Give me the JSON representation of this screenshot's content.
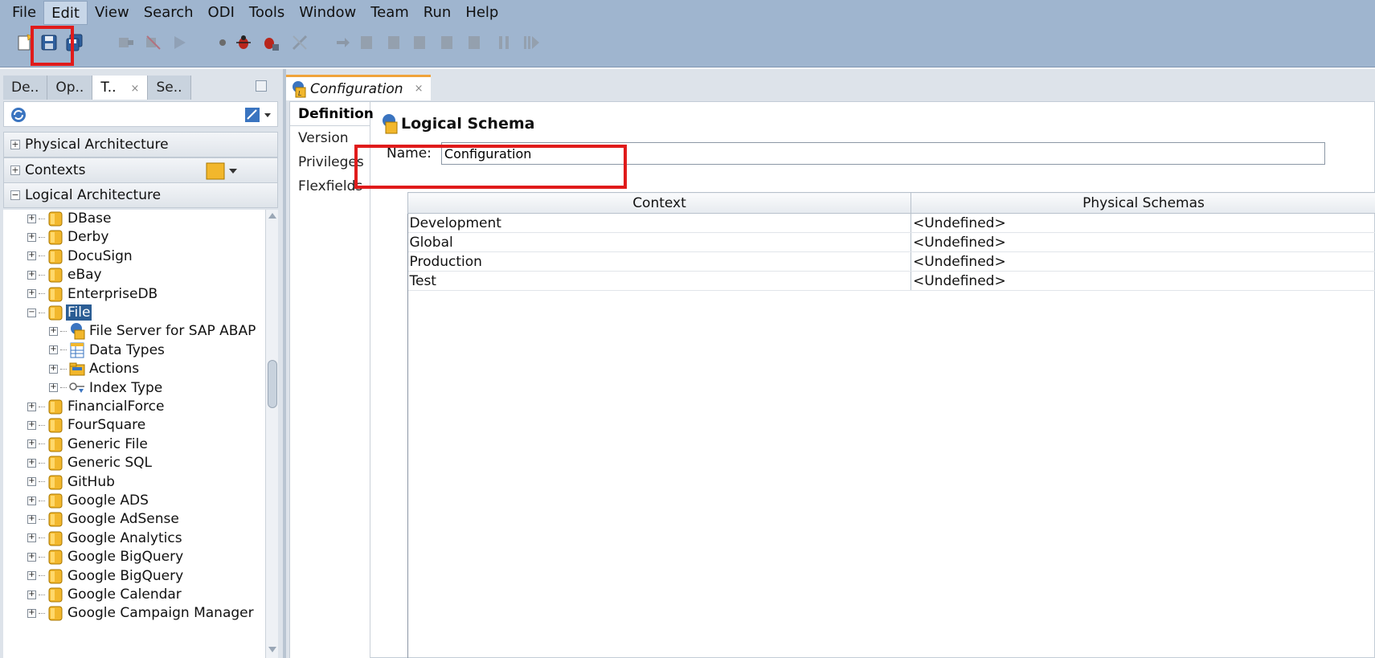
{
  "menu": [
    {
      "label": "File",
      "active": false
    },
    {
      "label": "Edit",
      "active": true
    },
    {
      "label": "View",
      "active": false
    },
    {
      "label": "Search",
      "active": false
    },
    {
      "label": "ODI",
      "active": false
    },
    {
      "label": "Tools",
      "active": false
    },
    {
      "label": "Window",
      "active": false
    },
    {
      "label": "Team",
      "active": false
    },
    {
      "label": "Run",
      "active": false
    },
    {
      "label": "Help",
      "active": false
    }
  ],
  "toolbar": {
    "icons": [
      "new-icon",
      "save-icon",
      "save-all-icon",
      "run-icon",
      "debug-icon"
    ],
    "highlight_color": "#e01b1b"
  },
  "navigator": {
    "tabs": [
      {
        "label": "De..",
        "active": false
      },
      {
        "label": "Op..",
        "active": false
      },
      {
        "label": "T..",
        "active": true
      },
      {
        "label": "Se..",
        "active": false
      }
    ],
    "close_glyph": "×",
    "accordions": {
      "physical": "Physical Architecture",
      "contexts": "Contexts",
      "logical": "Logical Architecture"
    },
    "tree": [
      {
        "label": "DBase",
        "level": 0,
        "icon": "tech-folder-icon"
      },
      {
        "label": "Derby",
        "level": 0,
        "icon": "tech-folder-icon"
      },
      {
        "label": "DocuSign",
        "level": 0,
        "icon": "tech-folder-icon"
      },
      {
        "label": "eBay",
        "level": 0,
        "icon": "tech-folder-icon"
      },
      {
        "label": "EnterpriseDB",
        "level": 0,
        "icon": "tech-folder-icon"
      },
      {
        "label": "File",
        "level": 0,
        "icon": "tech-folder-icon",
        "expanded": true,
        "selected": true
      },
      {
        "label": "File Server for SAP ABAP",
        "level": 1,
        "icon": "logical-schema-icon"
      },
      {
        "label": "Data Types",
        "level": 1,
        "icon": "datatypes-icon"
      },
      {
        "label": "Actions",
        "level": 1,
        "icon": "actions-folder-icon"
      },
      {
        "label": "Index Type",
        "level": 1,
        "icon": "index-key-icon"
      },
      {
        "label": "FinancialForce",
        "level": 0,
        "icon": "tech-folder-icon"
      },
      {
        "label": "FourSquare",
        "level": 0,
        "icon": "tech-folder-icon"
      },
      {
        "label": "Generic File",
        "level": 0,
        "icon": "tech-folder-icon"
      },
      {
        "label": "Generic SQL",
        "level": 0,
        "icon": "tech-folder-icon"
      },
      {
        "label": "GitHub",
        "level": 0,
        "icon": "tech-folder-icon"
      },
      {
        "label": "Google ADS",
        "level": 0,
        "icon": "tech-folder-icon"
      },
      {
        "label": "Google AdSense",
        "level": 0,
        "icon": "tech-folder-icon"
      },
      {
        "label": "Google Analytics",
        "level": 0,
        "icon": "tech-folder-icon"
      },
      {
        "label": "Google BigQuery",
        "level": 0,
        "icon": "tech-folder-icon"
      },
      {
        "label": "Google BigQuery",
        "level": 0,
        "icon": "tech-folder-icon"
      },
      {
        "label": "Google Calendar",
        "level": 0,
        "icon": "tech-folder-icon"
      },
      {
        "label": "Google Campaign Manager",
        "level": 0,
        "icon": "tech-folder-icon"
      }
    ]
  },
  "editor": {
    "tab_label": "Configuration",
    "vertical_tabs": [
      {
        "label": "Definition",
        "active": true
      },
      {
        "label": "Version",
        "active": false
      },
      {
        "label": "Privileges",
        "active": false
      },
      {
        "label": "Flexfields",
        "active": false
      }
    ],
    "section_title": "Logical Schema",
    "name_label": "Name:",
    "name_value": "Configuration",
    "table": {
      "columns": [
        "Context",
        "Physical Schemas"
      ],
      "rows": [
        [
          "Development",
          "<Undefined>"
        ],
        [
          "Global",
          "<Undefined>"
        ],
        [
          "Production",
          "<Undefined>"
        ],
        [
          "Test",
          "<Undefined>"
        ]
      ]
    }
  }
}
